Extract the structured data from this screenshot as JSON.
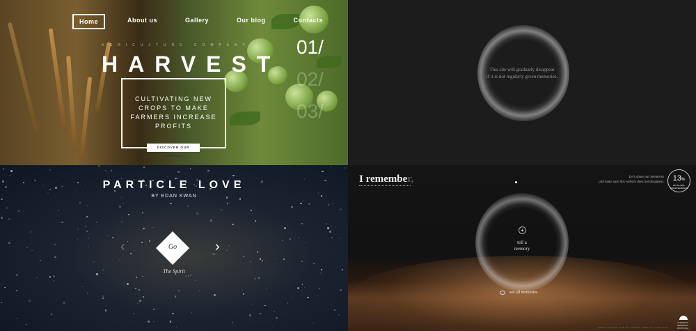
{
  "harvest": {
    "nav": [
      "Home",
      "About us",
      "Gallery",
      "Our blog",
      "Contacts"
    ],
    "kicker": "AGRICULTURE COMPANY",
    "title": "HARVEST",
    "slides": [
      "01/",
      "02/",
      "03/"
    ],
    "tagline": "CULTIVATING NEW\nCROPS TO MAKE\nFARMERS INCREASE\nPROFITS",
    "cta": "DISCOVER OUR COMPANY"
  },
  "disappear": {
    "message": "This site will gradually disappear\nif it is not regularly given memories."
  },
  "particle_love": {
    "title": "PARTICLE LOVE",
    "byline": "BY EDAN KWAN",
    "go_label": "Go",
    "prev_icon": "chevron-left-icon",
    "next_icon": "chevron-right-icon",
    "prev_glyph": "‹",
    "next_glyph": "›",
    "scene_label": "The Spirit"
  },
  "remember": {
    "typed_text": "I remembe",
    "ghost_text": "r,",
    "share_text": "Let's share our memories\nand make sure this website does not disappear.",
    "days_number": "13",
    "days_unit": "%",
    "days_sub": "DAYS UNTIL DISAPPEARANCE",
    "plus_glyph": "+",
    "tell_line1": "tell a",
    "tell_line2": "memory",
    "see_all": "see all memories",
    "footer": "ABOUT    SCHOOL    USE OF COOKIE    CREDITS    LANGUAGE",
    "logo_label": "CHRONOS\nREDESIGN\nPROPOSAL"
  },
  "colors": {
    "white": "#ffffff",
    "dark_panel": "#1c1c1c",
    "navy": "#0e1624",
    "gold": "#c99a52"
  }
}
